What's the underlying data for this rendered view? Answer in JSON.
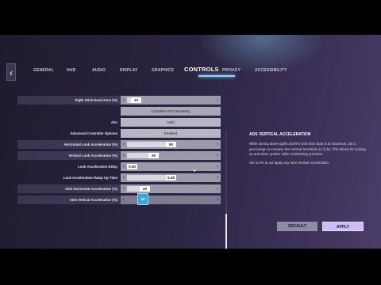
{
  "nav": {
    "tabs": [
      {
        "label": "GENERAL"
      },
      {
        "label": "HUD"
      },
      {
        "label": "AUDIO"
      },
      {
        "label": "DISPLAY"
      },
      {
        "label": "GRAPHICS"
      },
      {
        "label": "CONTROLS",
        "active": true
      },
      {
        "label": "PRIVACY"
      },
      {
        "label": "ACCESSIBILITY"
      }
    ]
  },
  "settings": {
    "right_stick_dead_zone": {
      "label": "Right Stick Dead Zone (%)",
      "value": "10",
      "level": 0.1
    },
    "controller_ads_sensitivity_header": "Controller ADS Sensitivity",
    "aim": {
      "label": "Aim",
      "value": "Hold"
    },
    "advanced_controller_options": {
      "label": "Advanced Controller Options",
      "value": "Enabled"
    },
    "horizontal_look_acceleration": {
      "label": "Horizontal Look Acceleration (%)",
      "value": "50",
      "level": 0.5
    },
    "vertical_look_acceleration": {
      "label": "Vertical Look Acceleration (%)",
      "value": "30",
      "level": 0.3
    },
    "look_acceleration_delay": {
      "label": "Look Acceleration Delay",
      "value": "0.00",
      "level": 0.0
    },
    "look_acceleration_ramp_up_time": {
      "label": "Look Acceleration Ramp Up Time",
      "value": "0.25",
      "level": 0.5
    },
    "ads_horizontal_acceleration": {
      "label": "ADS Horizontal Acceleration (%)",
      "value": "20",
      "level": 0.2
    },
    "ads_vertical_acceleration": {
      "label": "ADS Vertical Acceleration (%)",
      "value": "15",
      "level": 0.15
    }
  },
  "info_panel": {
    "title": "ADS VERTICAL ACCELERATION",
    "paragraph1": "While aiming down sights and the look stick input is at maximum, set a percentage to increase the Vertical Sensitivity (1:1) by. This allows for looking up and down quicker while maintaining precision.",
    "paragraph2": "Set to 0% to not apply any ADS Vertical Acceleration."
  },
  "buttons": {
    "default_label": "DEFAULT",
    "apply_label": "APPLY"
  },
  "icons": {
    "back": "chevron-left-icon",
    "arrow_left": "‹",
    "arrow_right": "›"
  },
  "colors": {
    "accent": "#8fd8ff",
    "selected_thumb": "#3aa6d8",
    "apply_button": "#c9bdf2"
  }
}
